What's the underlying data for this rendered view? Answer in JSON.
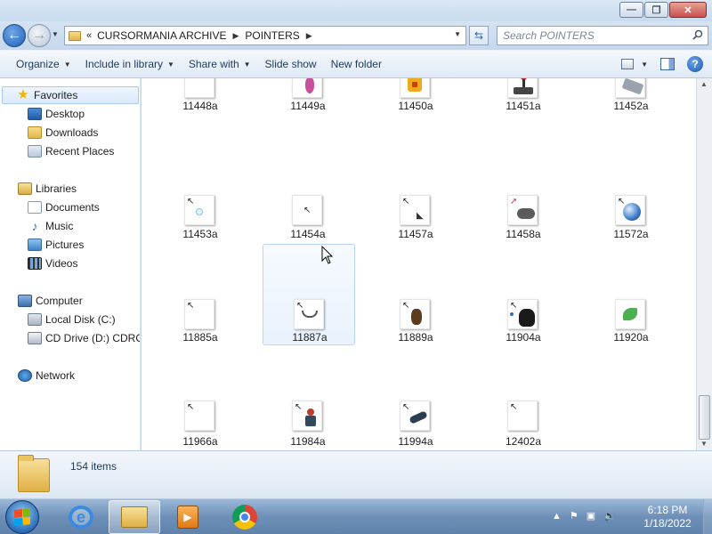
{
  "window": {
    "min_label": "—",
    "max_label": "❐",
    "close_label": "✕"
  },
  "navigation": {
    "back_glyph": "←",
    "forward_glyph": "→",
    "path": [
      "CURSORMANIA ARCHIVE",
      "POINTERS"
    ],
    "search_placeholder": "Search POINTERS"
  },
  "toolbar": {
    "organize": "Organize",
    "include_in_library": "Include in library",
    "share_with": "Share with",
    "slide_show": "Slide show",
    "new_folder": "New folder"
  },
  "sidebar": {
    "favorites": "Favorites",
    "desktop": "Desktop",
    "downloads": "Downloads",
    "recent_places": "Recent Places",
    "libraries": "Libraries",
    "documents": "Documents",
    "music": "Music",
    "pictures": "Pictures",
    "videos": "Videos",
    "computer": "Computer",
    "local_disk": "Local Disk (C:)",
    "cd_drive": "CD Drive (D:) CDROM",
    "network": "Network"
  },
  "files": [
    {
      "name": "11448a",
      "icon": "green-lizard-pointer"
    },
    {
      "name": "11449a",
      "icon": "pink-pterodactyl-pointer"
    },
    {
      "name": "11450a",
      "icon": "orange-house-pointer"
    },
    {
      "name": "11451a",
      "icon": "joystick-pointer"
    },
    {
      "name": "11452a",
      "icon": "card-tray-pointer"
    },
    {
      "name": "11453a",
      "icon": "bubble-pointer"
    },
    {
      "name": "11454a",
      "icon": "plain-arrow-pointer"
    },
    {
      "name": "11457a",
      "icon": "tool-arrow-pointer"
    },
    {
      "name": "11458a",
      "icon": "gamepad-pointer"
    },
    {
      "name": "11572a",
      "icon": "globe-pointer"
    },
    {
      "name": "11885a",
      "icon": "small-arrow-pointer"
    },
    {
      "name": "11887a",
      "icon": "bent-arrow-pointer"
    },
    {
      "name": "11889a",
      "icon": "running-figure-pointer"
    },
    {
      "name": "11904a",
      "icon": "black-cat-pointer"
    },
    {
      "name": "11920a",
      "icon": "green-leaf-pointer"
    },
    {
      "name": "11966a",
      "icon": "small-arrow-pointer"
    },
    {
      "name": "11984a",
      "icon": "figure-pointer"
    },
    {
      "name": "11994a",
      "icon": "swimmer-pointer"
    },
    {
      "name": "12402a",
      "icon": "small-arrow-pointer"
    }
  ],
  "status": {
    "item_count": "154 items"
  },
  "taskbar": {
    "time": "6:18 PM",
    "date": "1/18/2022"
  },
  "colors": {
    "accent": "#2a6fc0",
    "selection": "#e9f2fd",
    "taskbar": "#6e90b8"
  }
}
